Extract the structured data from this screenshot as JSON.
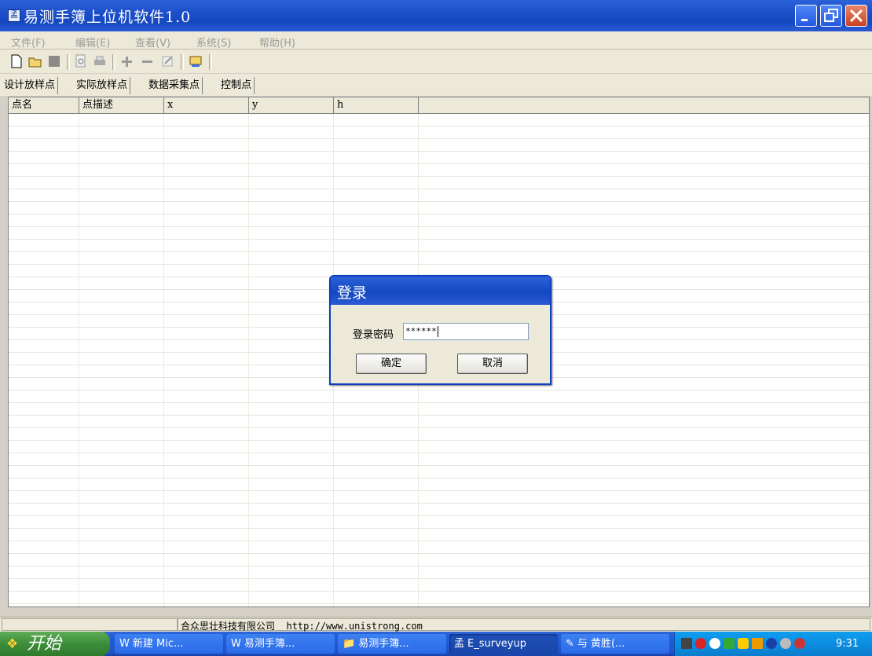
{
  "window": {
    "title": "易测手簿上位机软件1.0",
    "app_icon": "孟"
  },
  "menu": [
    "文件(F)",
    "编辑(E)",
    "查看(V)",
    "系统(S)",
    "帮助(H)"
  ],
  "tabs": [
    "设计放样点",
    "实际放样点",
    "数据采集点",
    "控制点"
  ],
  "table": {
    "columns": [
      "点名",
      "点描述",
      "x",
      "y",
      "h"
    ]
  },
  "login_dialog": {
    "title": "登录",
    "password_label": "登录密码",
    "password_value": "******",
    "ok_label": "确定",
    "cancel_label": "取消"
  },
  "status": {
    "company": "合众思壮科技有限公司",
    "url": "http://www.unistrong.com"
  },
  "taskbar": {
    "start_label": "开始",
    "tasks": [
      {
        "label": "新建 Mic...",
        "icon": "W"
      },
      {
        "label": "易测手簿...",
        "icon": "W"
      },
      {
        "label": "易测手簿...",
        "icon": "📁"
      },
      {
        "label": "E_surveyup",
        "icon": "孟"
      },
      {
        "label": "与 黄胜(...",
        "icon": "✎"
      }
    ],
    "clock": "9:31"
  },
  "colors": {
    "title_blue": "#1548c0",
    "taskbar_blue": "#245edb",
    "start_green": "#3c8d3a",
    "tray_blue": "#0c8de0"
  }
}
